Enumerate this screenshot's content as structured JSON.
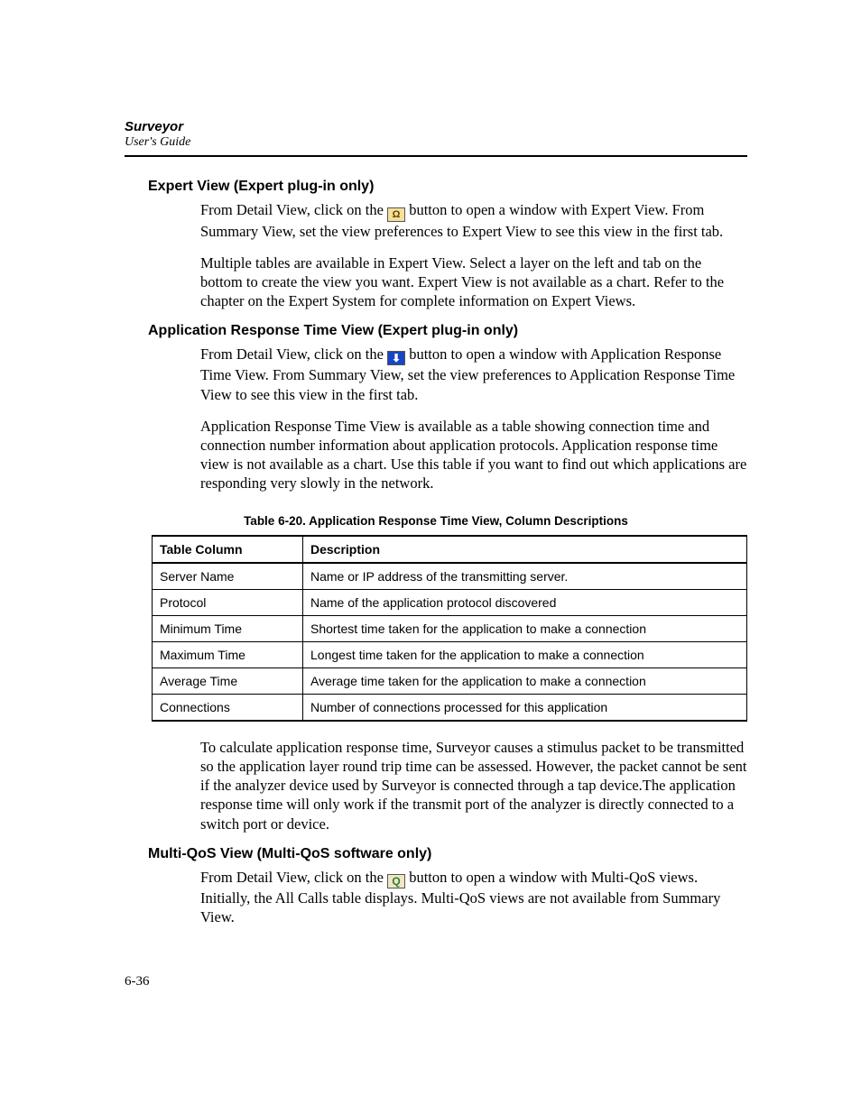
{
  "header": {
    "title": "Surveyor",
    "subtitle": "User's Guide"
  },
  "expert": {
    "heading": "Expert View (Expert plug-in only)",
    "p1a": "From Detail View, click on the ",
    "p1b": " button to open a window with Expert View. From Summary View, set the view preferences to Expert View to see this view in the first tab.",
    "p2": "Multiple tables are available in Expert View. Select a layer on the left and tab on the bottom to create the view you want. Expert View is not available as a chart. Refer to the chapter on the Expert System for complete information on Expert Views."
  },
  "art": {
    "heading": "Application Response Time View (Expert plug-in only)",
    "p1a": "From Detail View, click on the ",
    "p1b": " button to open a window with Application Response Time View. From Summary View, set the view preferences to Application Response Time View to see this view in the first tab.",
    "p2": "Application Response Time View is available as a table showing connection time and connection number information about application protocols. Application response time view is not available as a chart. Use this table if you want to find out which applications are responding very slowly in the network."
  },
  "table": {
    "caption": "Table 6-20. Application Response Time View, Column Descriptions",
    "head_col": "Table Column",
    "head_desc": "Description",
    "rows": [
      {
        "col": "Server Name",
        "desc": "Name or IP address of the transmitting server."
      },
      {
        "col": "Protocol",
        "desc": "Name of the application protocol discovered"
      },
      {
        "col": "Minimum Time",
        "desc": "Shortest time taken for the application to make a connection"
      },
      {
        "col": "Maximum Time",
        "desc": "Longest time taken for the application to make a connection"
      },
      {
        "col": "Average Time",
        "desc": "Average time taken for the application to make a connection"
      },
      {
        "col": "Connections",
        "desc": "Number of connections processed for this application"
      }
    ]
  },
  "art_after": "To calculate application response time, Surveyor causes a stimulus packet to be transmitted so the application layer round trip time can be assessed. However, the packet cannot be sent if the analyzer device used by Surveyor is connected through a tap device.The application response time will only work if the transmit port of the analyzer is directly connected to a switch port or device.",
  "qos": {
    "heading": "Multi-QoS View (Multi-QoS software only)",
    "p1a": "From Detail View, click on the ",
    "p1b": " button to open a window with Multi-QoS views. Initially, the All Calls table displays. Multi-QoS views are not available from Summary View."
  },
  "icons": {
    "expert_glyph": "Ω",
    "art_glyph": "⬇",
    "qos_glyph": "Q"
  },
  "footer": {
    "page_num": "6-36"
  }
}
